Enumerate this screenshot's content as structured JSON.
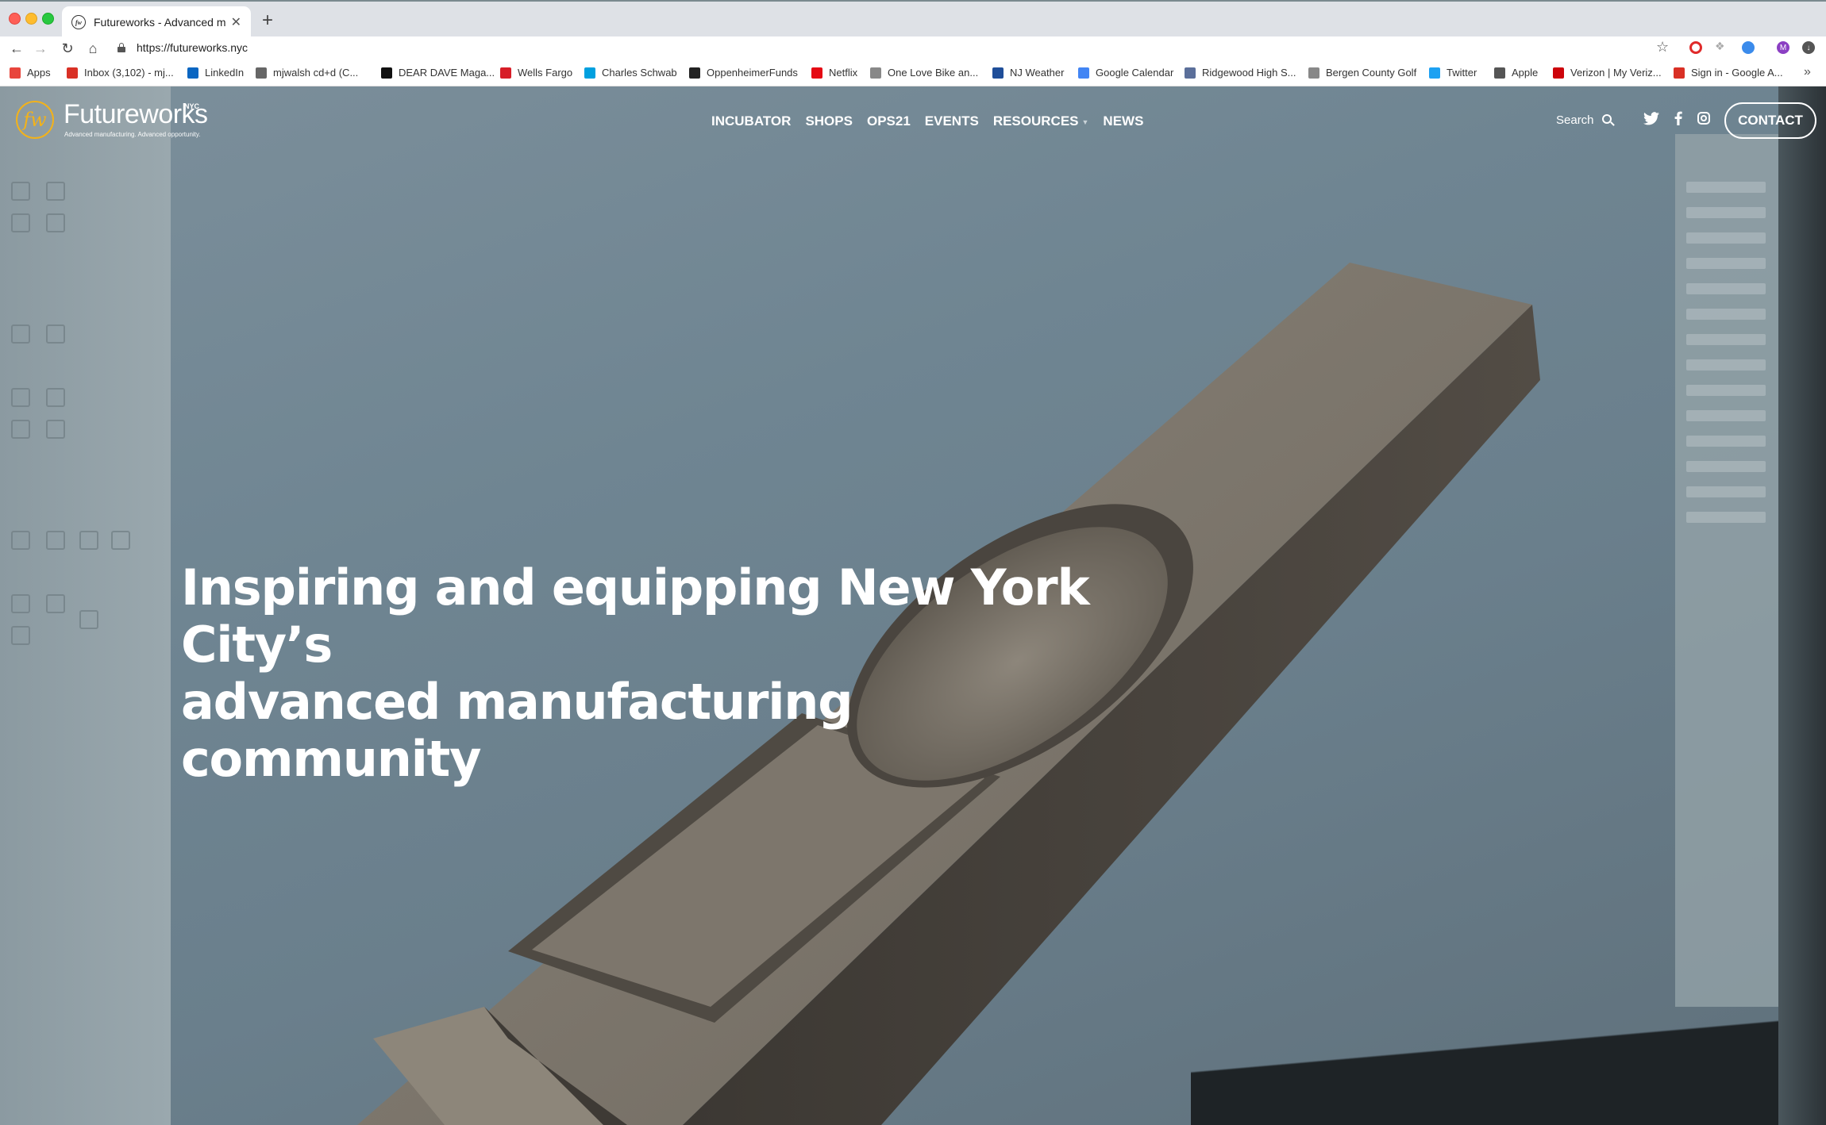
{
  "browser": {
    "tab_title": "Futureworks - Advanced manu",
    "tab_favicon": "fw",
    "new_tab_label": "+",
    "url": "https://futureworks.nyc",
    "avatar_initial": "M",
    "bookmarks_more": "»",
    "bookmarks": [
      {
        "label": "Apps",
        "icon": "apps-grid-icon",
        "color": "#e8453c"
      },
      {
        "label": "Inbox (3,102) - mj...",
        "icon": "gmail-icon",
        "color": "#d93025"
      },
      {
        "label": "LinkedIn",
        "icon": "linkedin-icon",
        "color": "#0a66c2"
      },
      {
        "label": "mjwalsh cd+d (C...",
        "icon": "page-icon",
        "color": "#666666"
      },
      {
        "label": "DEAR DAVE Maga...",
        "icon": "feather-icon",
        "color": "#111111"
      },
      {
        "label": "Wells Fargo",
        "icon": "wells-fargo-icon",
        "color": "#d71e28"
      },
      {
        "label": "Charles Schwab",
        "icon": "schwab-icon",
        "color": "#00a0df"
      },
      {
        "label": "OppenheimerFunds",
        "icon": "oppenheimer-icon",
        "color": "#222222"
      },
      {
        "label": "Netflix",
        "icon": "netflix-icon",
        "color": "#e50914"
      },
      {
        "label": "One Love Bike an...",
        "icon": "page-icon",
        "color": "#888888"
      },
      {
        "label": "NJ Weather",
        "icon": "weather-icon",
        "color": "#1f4e99"
      },
      {
        "label": "Google Calendar",
        "icon": "calendar-icon",
        "color": "#4285f4"
      },
      {
        "label": "Ridgewood High S...",
        "icon": "ridgewood-icon",
        "color": "#5b6f9a"
      },
      {
        "label": "Bergen County Golf",
        "icon": "page-icon",
        "color": "#888888"
      },
      {
        "label": "Twitter",
        "icon": "twitter-icon",
        "color": "#1da1f2"
      },
      {
        "label": "Apple",
        "icon": "apple-icon",
        "color": "#555555"
      },
      {
        "label": "Verizon | My Veriz...",
        "icon": "verizon-icon",
        "color": "#cd040b"
      },
      {
        "label": "Sign in - Google A...",
        "icon": "gmail-icon",
        "color": "#d93025"
      }
    ]
  },
  "site": {
    "logo_mark": "fw",
    "logo_word": "Futureworks",
    "logo_nyc": "NYC",
    "logo_tagline": "Advanced manufacturing. Advanced opportunity.",
    "nav": [
      "INCUBATOR",
      "SHOPS",
      "OPS21",
      "EVENTS",
      "RESOURCES",
      "NEWS"
    ],
    "search_label": "Search",
    "contact_label": "CONTACT",
    "hero_title_line1": "Inspiring and equipping New York City’s",
    "hero_title_line2": "advanced manufacturing community",
    "accent_color": "#f2b21b"
  }
}
